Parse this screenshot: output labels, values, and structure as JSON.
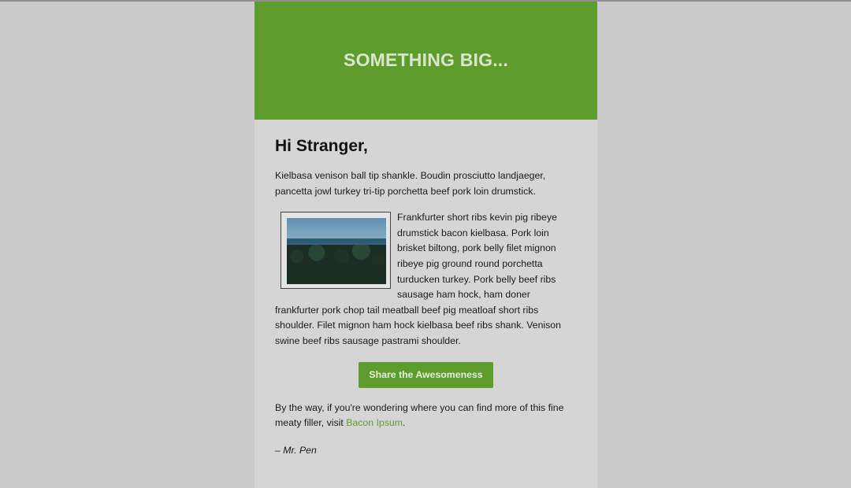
{
  "hero": {
    "title": "SOMETHING BIG..."
  },
  "content": {
    "greeting": "Hi Stranger,",
    "paragraph1": "Kielbasa venison ball tip shankle. Boudin prosciutto landjaeger, pancetta jowl turkey tri-tip porchetta beef pork loin drumstick.",
    "paragraph2": "Frankfurter short ribs kevin pig ribeye drumstick bacon kielbasa. Pork loin brisket biltong, pork belly filet mignon ribeye pig ground round porchetta turducken turkey. Pork belly beef ribs sausage ham hock, ham doner frankfurter pork chop tail meatball beef pig meatloaf short ribs shoulder. Filet mignon ham hock kielbasa beef ribs shank. Venison swine beef ribs sausage pastrami shoulder.",
    "cta_label": "Share the Awesomeness",
    "paragraph3_prefix": "By the way, if you're wondering where you can find more of this fine meaty filler, visit ",
    "paragraph3_link": "Bacon Ipsum",
    "paragraph3_suffix": ".",
    "signature": "– Mr. Pen"
  },
  "colors": {
    "accent": "#5e9c2e",
    "background": "#cbcbcb",
    "email_background": "#d5d5d5"
  }
}
